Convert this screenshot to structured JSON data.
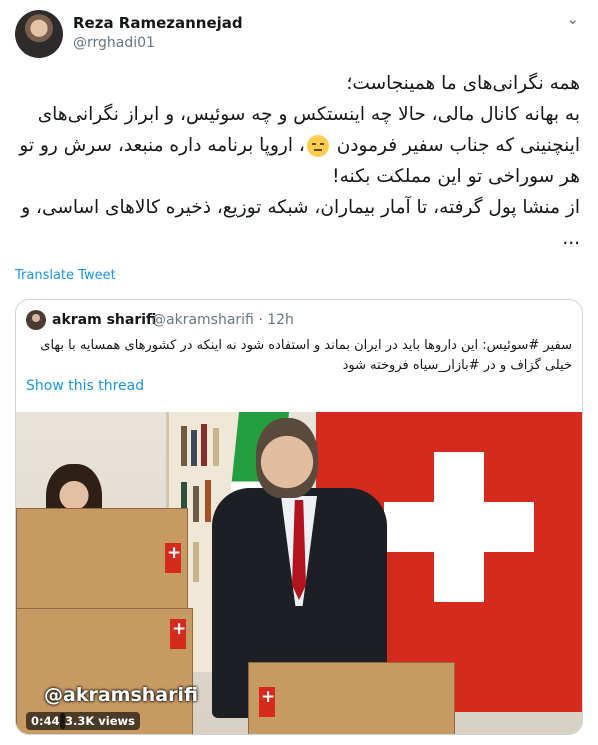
{
  "author": {
    "display_name": "Reza Ramezannejad",
    "handle": "@rrghadi01",
    "avatar_icon": "avatar-photo",
    "menu_icon": "chevron-down-icon"
  },
  "tweet": {
    "lines": [
      "همه نگرانی‌های ما همینجاست؛",
      "به بهانه کانال مالی، حالا چه اینستکس و چه سوئیس، و ابراز نگرانی‌های",
      "اینچنینی که جناب سفیر فرمودن",
      "، اروپا برنامه داره منبعد، سرش رو تو",
      "هر سوراخی تو این مملکت بکنه!",
      "از منشا پول گرفته، تا آمار بیماران، شبکه توزیع، ذخیره کالاهای اساسی، و",
      "..."
    ],
    "emoji": "unamused-face",
    "translate_label": "Translate Tweet"
  },
  "quoted": {
    "display_name": "akram sharifi",
    "handle_time": "@akramsharifi · 12h",
    "text": "سفیر #سوئیس: این داروها باید در ایران بماند و استفاده شود نه اینکه در کشورهای همسایه با بهای خیلی گزاف و در #بازار_سیاه فروخته شود",
    "show_thread_label": "Show this thread",
    "video": {
      "watermark": "@akramsharifi",
      "duration": "0:44",
      "views": "3.3K views"
    }
  },
  "colors": {
    "link": "#1b95e0",
    "text": "#14171a",
    "muted": "#657786",
    "border": "#ccd6dd",
    "swiss_red": "#d52b1e"
  }
}
